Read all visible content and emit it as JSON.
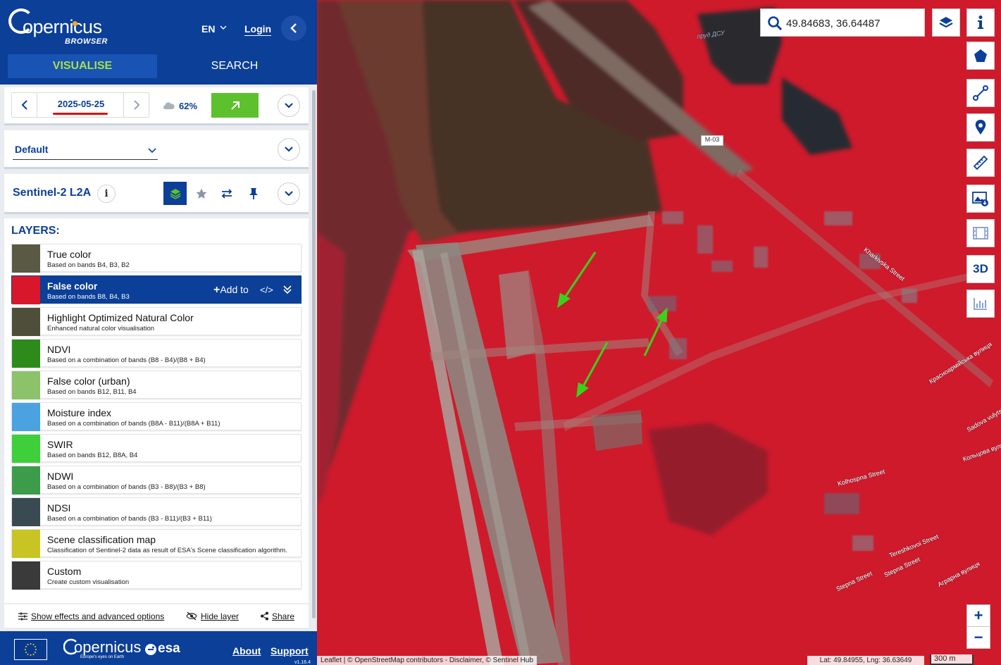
{
  "header": {
    "logo_word": "opernicus",
    "logo_sub": "BROWSER",
    "language": "EN",
    "login": "Login",
    "tabs": [
      {
        "label": "VISUALISE",
        "active": true
      },
      {
        "label": "SEARCH",
        "active": false
      }
    ]
  },
  "date_card": {
    "date": "2025-05-25",
    "cloud_cover": "62%"
  },
  "theme": {
    "selected": "Default"
  },
  "collection": {
    "name": "Sentinel-2 L2A"
  },
  "layers": {
    "title": "LAYERS:",
    "add_to": "Add to",
    "code": "</>",
    "items": [
      {
        "name": "True color",
        "desc": "Based on bands B4, B3, B2",
        "thumb": "#5a5a44"
      },
      {
        "name": "False color",
        "desc": "Based on bands B8, B4, B3",
        "thumb": "#d8182a",
        "selected": true
      },
      {
        "name": "Highlight Optimized Natural Color",
        "desc": "Enhanced natural color visualisation",
        "thumb": "#4e4e3a"
      },
      {
        "name": "NDVI",
        "desc": "Based on a combination of bands (B8 - B4)/(B8 + B4)",
        "thumb": "#2f8a1c"
      },
      {
        "name": "False color (urban)",
        "desc": "Based on bands B12, B11, B4",
        "thumb": "#8cc26a"
      },
      {
        "name": "Moisture index",
        "desc": "Based on a combination of bands (B8A - B11)/(B8A + B11)",
        "thumb": "#4aa2e0"
      },
      {
        "name": "SWIR",
        "desc": "Based on bands B12, B8A, B4",
        "thumb": "#3fcf3a"
      },
      {
        "name": "NDWI",
        "desc": "Based on a combination of bands (B3 - B8)/(B3 + B8)",
        "thumb": "#3c9c4a"
      },
      {
        "name": "NDSI",
        "desc": "Based on a combination of bands (B3 - B11)/(B3 + B11)",
        "thumb": "#3a4a52"
      },
      {
        "name": "Scene classification map",
        "desc": "Classification of Sentinel-2 data as result of ESA's Scene classification algorithm.",
        "thumb": "#c8c424"
      },
      {
        "name": "Custom",
        "desc": "Create custom visualisation",
        "thumb": "#3a3a3a"
      }
    ]
  },
  "bottom_links": {
    "effects": "Show effects and advanced options",
    "hide": "Hide layer",
    "share": "Share"
  },
  "footer": {
    "copernicus": "opernicus",
    "copernicus_tag": "Europe's eyes on Earth",
    "esa": "esa",
    "about": "About",
    "support": "Support",
    "version": "v1.16.4"
  },
  "map": {
    "search_value": "49.84683, 36.64487",
    "btn_3d": "3D",
    "zoom_in": "+",
    "zoom_out": "−",
    "attribution": "Leaflet | © OpenStreetMap contributors - Disclaimer, © Sentinel Hub",
    "coords": "Lat: 49.84955, Lng: 36.63649",
    "scale": "300 m",
    "road_tag": "M-03",
    "labels": {
      "pond": "пруд ДСУ",
      "kharkivska": "Kharkivska Street",
      "krasnoarmiyska": "Красноармійська вулиця",
      "sadova": "Sadova vulytsia",
      "koltsova": "Кольцова вулиця",
      "kolhospna": "Kolhospna Street",
      "tereshkovoi": "Tereshkovoi Street",
      "stepova1": "Stepna Street",
      "stepova2": "Stepna Street",
      "agrarna": "Аграрна вулиця"
    }
  }
}
